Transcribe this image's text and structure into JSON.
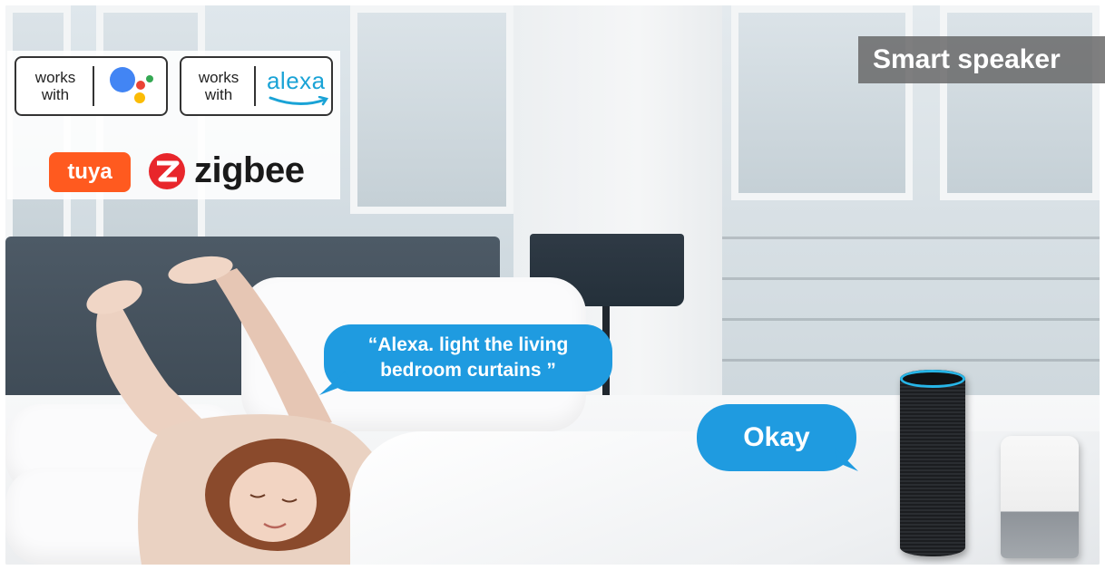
{
  "banner": {
    "title": "Smart speaker"
  },
  "badges": {
    "google": {
      "works_label": "works\nwith"
    },
    "alexa": {
      "works_label": "works\nwith",
      "brand_word": "alexa"
    },
    "tuya_word": "tuya",
    "zigbee_word": "zigbee"
  },
  "dialogue": {
    "command": "“Alexa. light the living bedroom curtains ”",
    "reply": "Okay"
  },
  "colors": {
    "bubble": "#1f9be0",
    "tuya": "#ff5a1f",
    "zigbee": "#e8262b",
    "alexa": "#1aa3d6",
    "echo_ring": "#27b6e8"
  }
}
